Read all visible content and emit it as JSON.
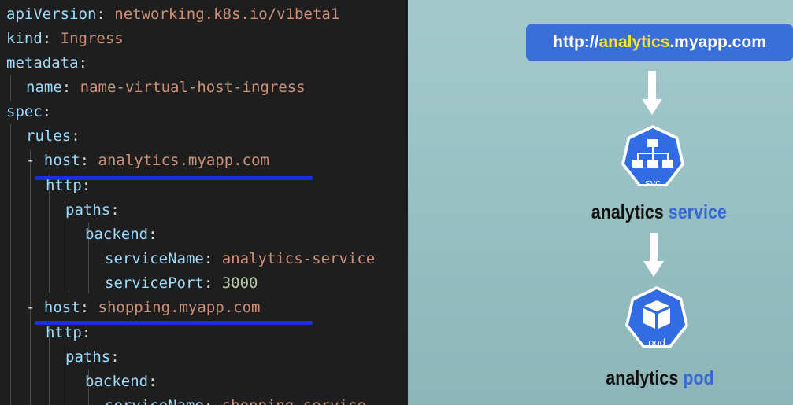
{
  "code": {
    "apiVersion_key": "apiVersion",
    "apiVersion_val": "networking.k8s.io/v1beta1",
    "kind_key": "kind",
    "kind_val": "Ingress",
    "metadata_key": "metadata",
    "name_key": "name",
    "name_val": "name-virtual-host-ingress",
    "spec_key": "spec",
    "rules_key": "rules",
    "host_key": "host",
    "http_key": "http",
    "paths_key": "paths",
    "backend_key": "backend",
    "serviceName_key": "serviceName",
    "servicePort_key": "servicePort",
    "rule1_host": "analytics.myapp.com",
    "rule1_serviceName": "analytics-service",
    "rule1_servicePort": "3000",
    "rule2_host": "shopping.myapp.com",
    "rule2_serviceName": "shopping-service"
  },
  "diagram": {
    "url_prefix": "http://",
    "url_host": "analytics",
    "url_suffix": ".myapp.com",
    "svc_caption": "svc",
    "service_label_name": "analytics",
    "service_label_type": "service",
    "pod_caption": "pod",
    "pod_label_name": "analytics",
    "pod_label_type": "pod"
  },
  "colors": {
    "underline": "#1a2fe0",
    "url_box": "#3b6fd8",
    "url_highlight": "#ffe32b",
    "k8s_blue": "#326ce5",
    "accent_text": "#3567d6"
  }
}
